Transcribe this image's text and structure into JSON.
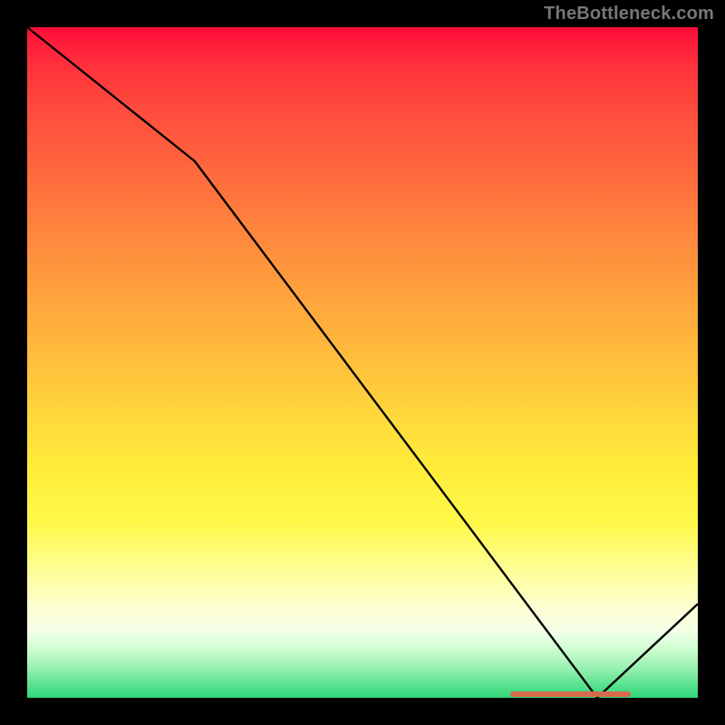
{
  "watermark": "TheBottleneck.com",
  "chart_data": {
    "type": "line",
    "title": "",
    "xlabel": "",
    "ylabel": "",
    "xlim": [
      0,
      100
    ],
    "ylim": [
      0,
      100
    ],
    "grid": false,
    "legend": false,
    "background_gradient": {
      "top": "#ff0d3a",
      "mid": "#ffe33c",
      "bottom": "#2fd57a"
    },
    "series": [
      {
        "name": "bottleneck-curve",
        "x": [
          0,
          25,
          85,
          100
        ],
        "values": [
          100,
          80,
          0,
          14
        ]
      }
    ],
    "annotations": [
      {
        "name": "optimal-range-marker",
        "type": "segment",
        "y": 0,
        "x_start": 72,
        "x_end": 90,
        "color": "#d66a4a"
      }
    ]
  }
}
